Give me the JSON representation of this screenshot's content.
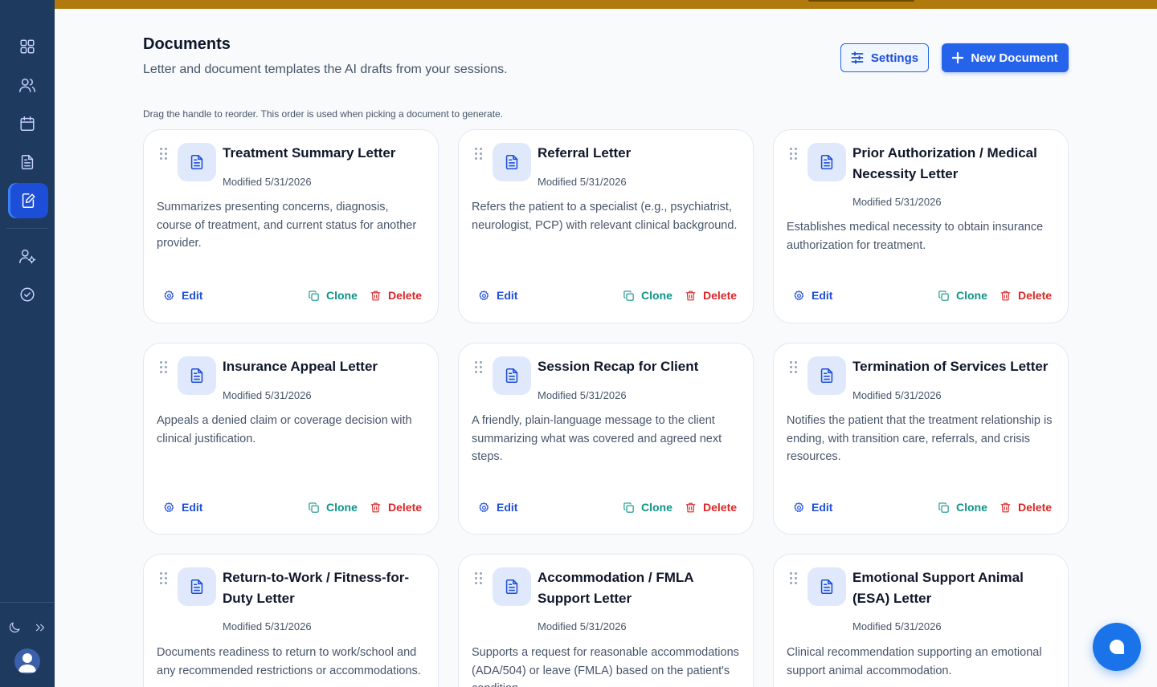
{
  "header": {
    "title": "Documents",
    "subtitle": "Letter and document templates the AI drafts from your sessions.",
    "settings_label": "Settings",
    "new_document_label": "New Document",
    "hint": "Drag the handle to reorder. This order is used when picking a document to generate."
  },
  "sidebar": {
    "items": [
      {
        "icon": "dashboard-icon",
        "active": false
      },
      {
        "icon": "users-icon",
        "active": false
      },
      {
        "icon": "calendar-icon",
        "active": false
      },
      {
        "icon": "file-text-icon",
        "active": false
      },
      {
        "icon": "document-edit-icon",
        "active": true
      },
      {
        "icon": "user-settings-icon",
        "active": false
      },
      {
        "icon": "check-circle-icon",
        "active": false
      }
    ],
    "footer": [
      "moon-icon",
      "expand-icon",
      "avatar"
    ]
  },
  "actions": {
    "edit": "Edit",
    "clone": "Clone",
    "delete": "Delete"
  },
  "documents": [
    {
      "title": "Treatment Summary Letter",
      "modified": "Modified 5/31/2026",
      "description": "Summarizes presenting concerns, diagnosis, course of treatment, and current status for another provider."
    },
    {
      "title": "Referral Letter",
      "modified": "Modified 5/31/2026",
      "description": "Refers the patient to a specialist (e.g., psychiatrist, neurologist, PCP) with relevant clinical background."
    },
    {
      "title": "Prior Authorization / Medical Necessity Letter",
      "modified": "Modified 5/31/2026",
      "description": "Establishes medical necessity to obtain insurance authorization for treatment."
    },
    {
      "title": "Insurance Appeal Letter",
      "modified": "Modified 5/31/2026",
      "description": "Appeals a denied claim or coverage decision with clinical justification."
    },
    {
      "title": "Session Recap for Client",
      "modified": "Modified 5/31/2026",
      "description": "A friendly, plain-language message to the client summarizing what was covered and agreed next steps."
    },
    {
      "title": "Termination of Services Letter",
      "modified": "Modified 5/31/2026",
      "description": "Notifies the patient that the treatment relationship is ending, with transition care, referrals, and crisis resources."
    },
    {
      "title": "Return-to-Work / Fitness-for-Duty Letter",
      "modified": "Modified 5/31/2026",
      "description": "Documents readiness to return to work/school and any recommended restrictions or accommodations."
    },
    {
      "title": "Accommodation / FMLA Support Letter",
      "modified": "Modified 5/31/2026",
      "description": "Supports a request for reasonable accommodations (ADA/504) or leave (FMLA) based on the patient's condition."
    },
    {
      "title": "Emotional Support Animal (ESA) Letter",
      "modified": "Modified 5/31/2026",
      "description": "Clinical recommendation supporting an emotional support animal accommodation."
    }
  ],
  "colors": {
    "sidebar": "#1e3a5f",
    "accent": "#2563eb",
    "banner": "#b07a0c",
    "clone": "#0d9488",
    "delete": "#dc2626"
  }
}
